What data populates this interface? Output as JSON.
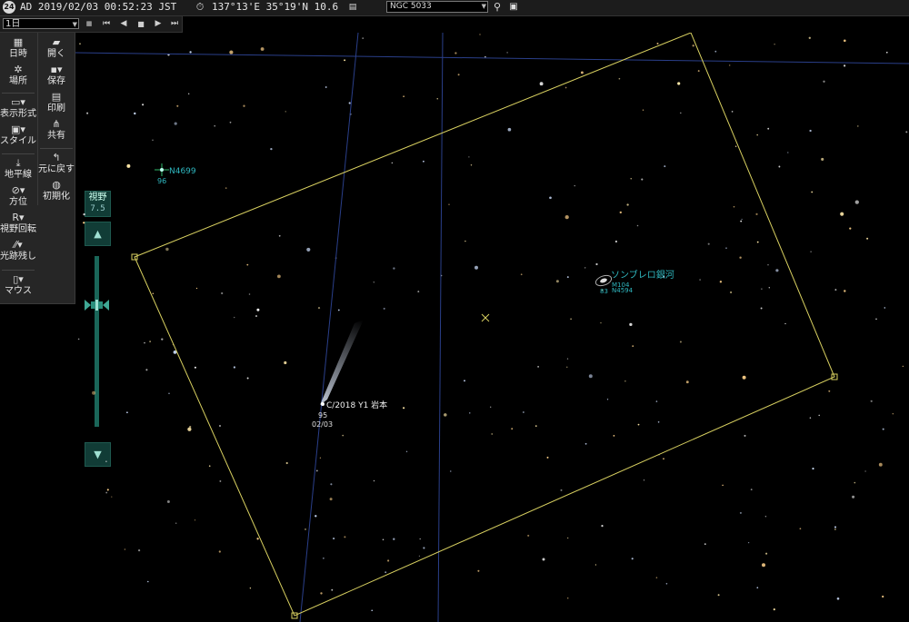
{
  "topbar": {
    "era_icon": "24",
    "datetime": "AD 2019/02/03 00:52:23 JST",
    "location": "137°13'E 35°19'N 10.6",
    "search_value": "NGC 5033"
  },
  "playback": {
    "speed": "1日"
  },
  "toolbar": {
    "left": [
      {
        "icon": "calendar-icon",
        "label": "日時"
      },
      {
        "icon": "location-icon",
        "label": "場所"
      },
      {
        "icon": "display-format-icon",
        "label": "表示形式"
      },
      {
        "icon": "style-icon",
        "label": "スタイル"
      },
      {
        "icon": "horizon-icon",
        "label": "地平線"
      },
      {
        "icon": "compass-icon",
        "label": "方位"
      },
      {
        "icon": "rotate-icon",
        "label": "視野回転"
      },
      {
        "icon": "trail-icon",
        "label": "光跡残し"
      },
      {
        "icon": "mouse-icon",
        "label": "マウス"
      }
    ],
    "right": [
      {
        "icon": "folder-icon",
        "label": "開く"
      },
      {
        "icon": "save-icon",
        "label": "保存"
      },
      {
        "icon": "print-icon",
        "label": "印刷"
      },
      {
        "icon": "share-icon",
        "label": "共有"
      },
      {
        "icon": "undo-icon",
        "label": "元に戻す"
      },
      {
        "icon": "reset-icon",
        "label": "初期化"
      }
    ]
  },
  "fov": {
    "label": "視野",
    "value": "7.5"
  },
  "sky": {
    "n4699_name": "N4699",
    "n4699_mag": "96",
    "sombrero_name": "ソンブレロ銀河",
    "sombrero_m": "M104",
    "sombrero_ngc": "N4594",
    "sombrero_mag": "83",
    "comet_name": "C/2018 Y1 岩本",
    "comet_mag": "95",
    "comet_date": "02/03"
  },
  "colors": {
    "frame": "#d8d060",
    "grid": "#2a3f8a",
    "label_cyan": "#2fb8c0",
    "panel": "#262626",
    "fov_panel": "#113c36"
  }
}
